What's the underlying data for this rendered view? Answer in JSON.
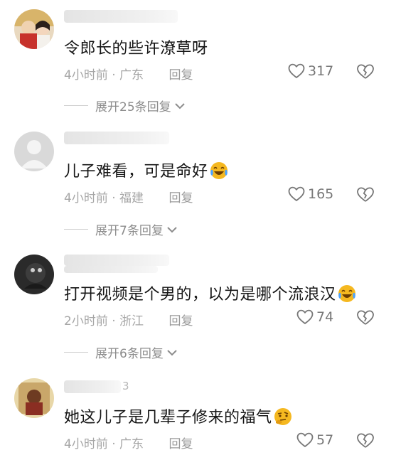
{
  "comments": [
    {
      "text": "令郎长的些许潦草呀",
      "time": "4小时前",
      "location": "广东",
      "reply_label": "回复",
      "likes": "317",
      "expand_label": "展开25条回复",
      "avatar_icon": "user-avatar-photo"
    },
    {
      "text": "儿子难看，可是命好",
      "emoji_icon": "laughing-tears-emoji",
      "time": "4小时前",
      "location": "福建",
      "reply_label": "回复",
      "likes": "165",
      "expand_label": "展开7条回复",
      "avatar_icon": "default-avatar"
    },
    {
      "text": "打开视频是个男的，以为是哪个流浪汉",
      "emoji_icon": "laughing-tears-emoji",
      "time": "2小时前",
      "location": "浙江",
      "reply_label": "回复",
      "likes": "74",
      "expand_label": "展开6条回复",
      "avatar_icon": "user-avatar-photo"
    },
    {
      "text": "她这儿子是几辈子修来的福气",
      "emoji_icon": "thinking-emoji",
      "name_fragment": "3",
      "time": "4小时前",
      "location": "广东",
      "reply_label": "回复",
      "likes": "57",
      "avatar_icon": "user-avatar-photo"
    }
  ],
  "separator": " · ",
  "colors": {
    "text": "#161616",
    "meta": "#a6a6a6",
    "emoji": "#f5b820"
  }
}
